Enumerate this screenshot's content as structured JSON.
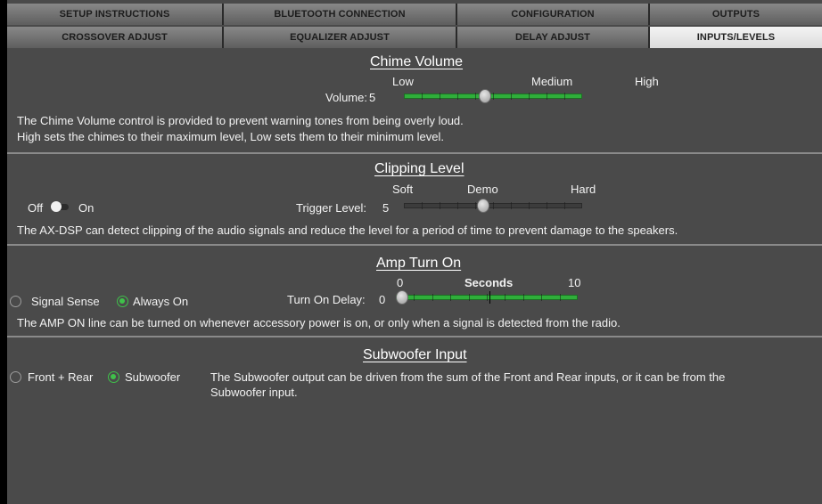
{
  "tabs": {
    "row1": [
      "SETUP INSTRUCTIONS",
      "BLUETOOTH CONNECTION",
      "CONFIGURATION",
      "OUTPUTS"
    ],
    "row2": [
      "CROSSOVER ADJUST",
      "EQUALIZER ADJUST",
      "DELAY ADJUST",
      "INPUTS/LEVELS"
    ],
    "active": "INPUTS/LEVELS"
  },
  "chime": {
    "title": "Chime Volume",
    "low": "Low",
    "medium": "Medium",
    "high": "High",
    "volume_label": "Volume:",
    "volume_value": "5",
    "slider_fraction": 0.45,
    "desc1": "The Chime Volume control is provided to prevent warning tones from being overly loud.",
    "desc2": "High sets the chimes to their maximum level, Low sets them to their minimum level."
  },
  "clipping": {
    "title": "Clipping Level",
    "soft": "Soft",
    "demo": "Demo",
    "hard": "Hard",
    "off": "Off",
    "on": "On",
    "toggle_on": false,
    "trigger_label": "Trigger Level:",
    "trigger_value": "5",
    "slider_fraction": 0.44,
    "desc": "The AX-DSP can detect clipping of the audio signals and reduce the level for a period of time to prevent damage to the speakers."
  },
  "amp": {
    "title": "Amp Turn On",
    "min": "0",
    "unit": "Seconds",
    "max": "10",
    "signal_sense": "Signal Sense",
    "always_on": "Always On",
    "selected": "Always On",
    "delay_label": "Turn On Delay:",
    "delay_value": "0",
    "slider_fraction": 0.0,
    "desc": "The AMP ON line can be turned on whenever accessory power is on, or only when a signal is detected from the radio."
  },
  "subwoofer": {
    "title": "Subwoofer Input",
    "front_rear": "Front + Rear",
    "subwoofer": "Subwoofer",
    "selected": "Subwoofer",
    "desc1": "The Subwoofer output can be driven from the sum of the Front and Rear inputs, or it can be from the",
    "desc2": "Subwoofer input."
  },
  "colors": {
    "accent": "#2fae3a",
    "background": "#4a4a4a",
    "tab_active": "#eaeaea"
  }
}
